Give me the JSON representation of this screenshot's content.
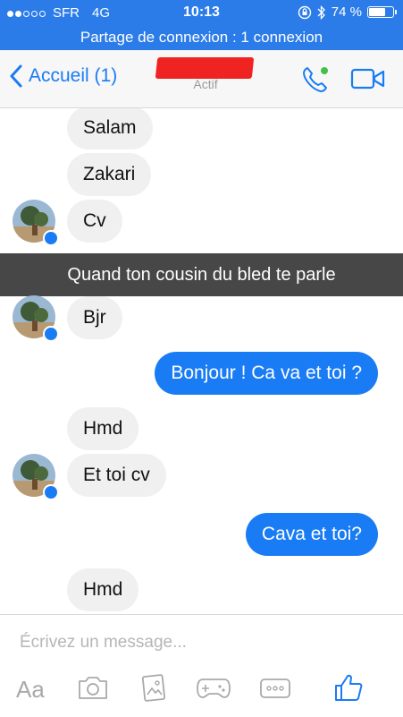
{
  "statusbar": {
    "carrier": "SFR",
    "network": "4G",
    "time": "10:13",
    "battery": "74 %",
    "battery_level": 0.74,
    "signal_bars": 2
  },
  "banner": {
    "text": "Partage de connexion : 1 connexion"
  },
  "nav": {
    "back_label": "Accueil (1)",
    "contact_status": "Actif"
  },
  "messages": {
    "m1": "Salam",
    "m2": "Zakari",
    "m3": "Cv",
    "m4": "Bjr",
    "m5": "Bonjour ! Ca va et toi ?",
    "m6": "Hmd",
    "m7": "Et toi cv",
    "m8": "Cava et toi?",
    "m9": "Hmd"
  },
  "caption": "Quand ton cousin du bled te parle",
  "composer": {
    "placeholder": "Écrivez un message...",
    "aa_label": "Aa"
  },
  "colors": {
    "accent": "#1a7cf4",
    "statusbar": "#2b7ce9",
    "redaction": "#f02323"
  }
}
